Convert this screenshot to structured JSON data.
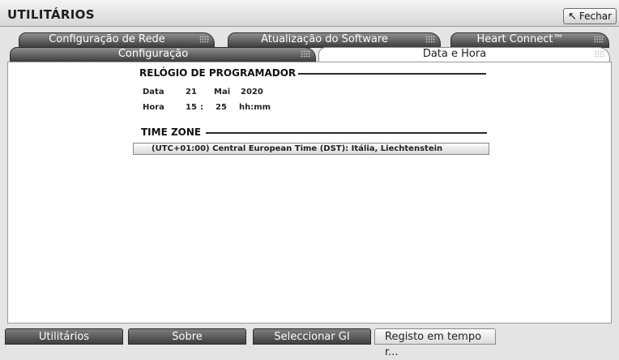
{
  "window": {
    "title": "UTILITÁRIOS",
    "close_label": "Fechar",
    "close_icon": "arrow-up-left-icon"
  },
  "tabs": {
    "back_row": [
      "Configuração de Rede",
      "Atualização do Software",
      "Heart Connect™"
    ],
    "front_row": [
      "Configuração",
      "Data e Hora"
    ],
    "active": "Data e Hora"
  },
  "clock": {
    "heading": "RELÓGIO DE PROGRAMADOR",
    "date_label": "Data",
    "day": "21",
    "month": "Mai",
    "year": "2020",
    "time_label": "Hora",
    "hour": "15",
    "separator": ":",
    "minute": "25",
    "format": "hh:mm"
  },
  "timezone": {
    "heading": "TIME ZONE",
    "selected": "(UTC+01:00) Central European Time (DST): Itália, Liechtenstein"
  },
  "bottom_nav": [
    "Utilitários",
    "Sobre",
    "Seleccionar GI",
    "Registo em tempo r..."
  ]
}
